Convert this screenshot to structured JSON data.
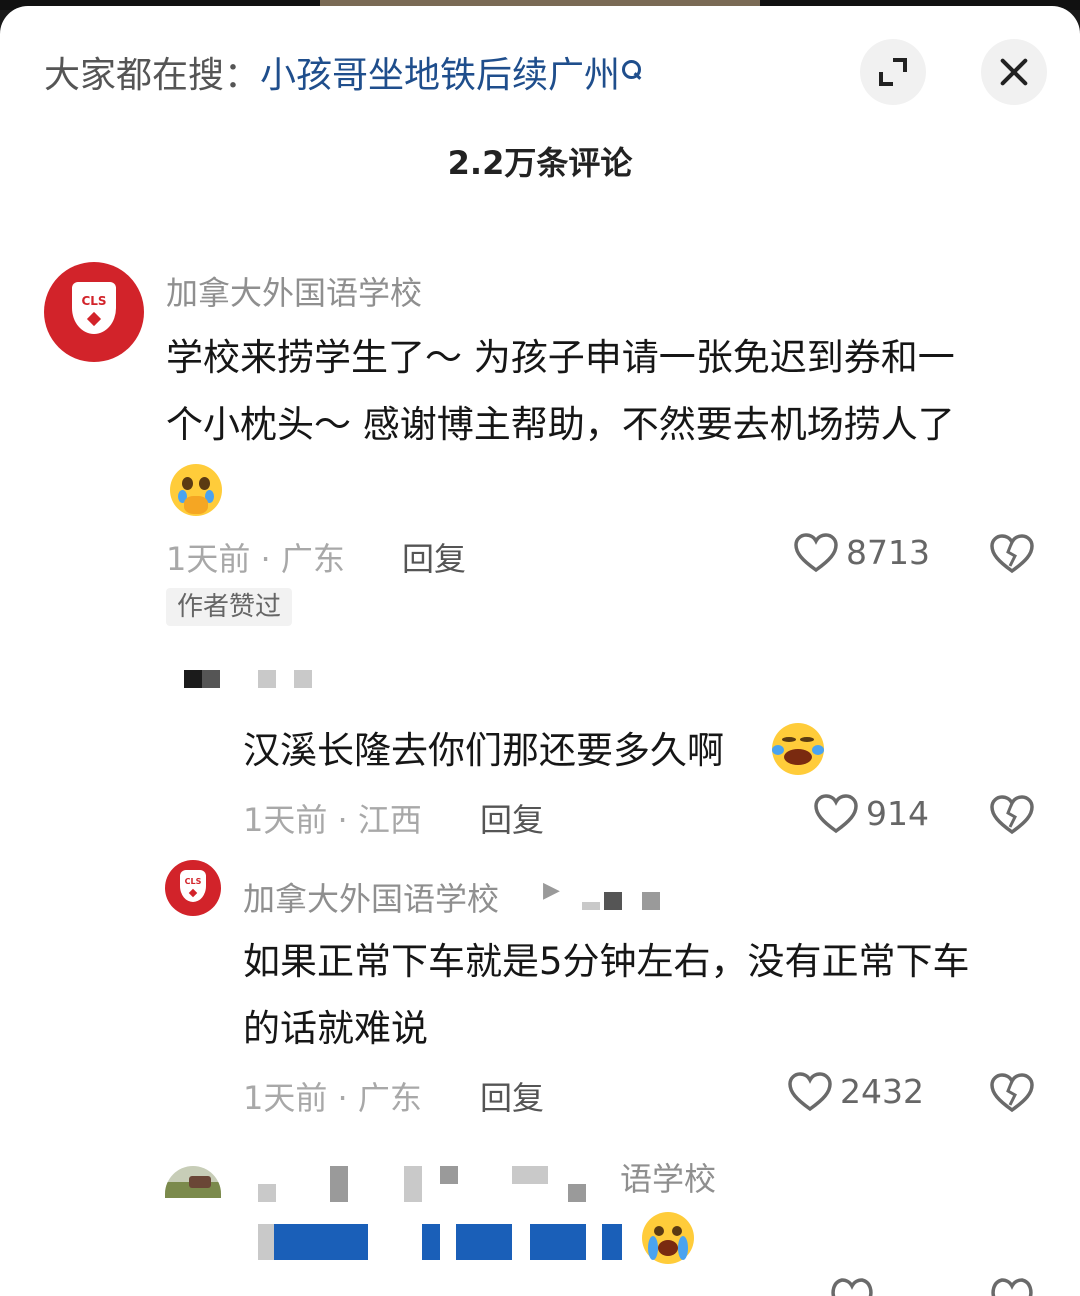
{
  "header": {
    "search_prefix": "大家都在搜：",
    "search_term": "小孩哥坐地铁后续广州",
    "search_icon": "search-icon",
    "expand_icon": "expand-icon",
    "close_icon": "close-icon",
    "comment_count": "2.2万条评论"
  },
  "comments": [
    {
      "username": "加拿大外国语学校",
      "avatar_text": "CLS",
      "text_line1": "学校来捞学生了～ 为孩子申请一张免迟到券和一",
      "text_line2": "个小枕头～ 感谢博主帮助，不然要去机场捞人了",
      "emoji": "pleading-hands-emoji",
      "meta": "1天前 · 广东",
      "reply_label": "回复",
      "likes": "8713",
      "badge": "作者赞过"
    }
  ],
  "replies": [
    {
      "username": "",
      "text": "汉溪长隆去你们那还要多久啊",
      "emoji": "laughing-crying-emoji",
      "meta": "1天前 · 江西",
      "reply_label": "回复",
      "likes": "914"
    },
    {
      "username": "加拿大外国语学校",
      "avatar_text": "CLS",
      "reply_arrow": "▶",
      "text_line1": "如果正常下车就是5分钟左右，没有正常下车",
      "text_line2": "的话就难说",
      "meta": "1天前 · 广东",
      "reply_label": "回复",
      "likes": "2432"
    },
    {
      "username_fragment": "语学校",
      "emoji": "loudly-crying-emoji"
    }
  ],
  "colors": {
    "search_link": "#1f4e8c",
    "avatar_red": "#d2232a",
    "muted_text": "#8f8f8f"
  }
}
